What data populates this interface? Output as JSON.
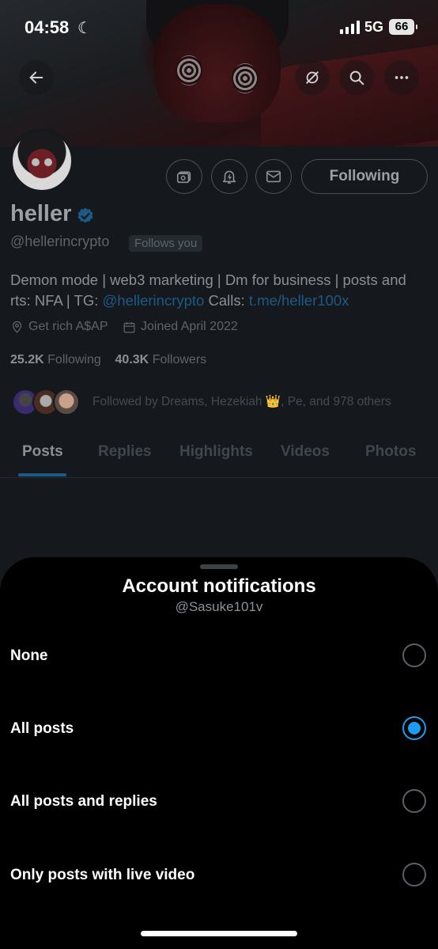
{
  "status_bar": {
    "time": "04:58",
    "network": "5G",
    "battery": "66"
  },
  "profile": {
    "name": "heller",
    "handle": "@hellerincrypto",
    "follows_you": "Follows you",
    "following_button": "Following",
    "bio_text": "Demon mode | web3 marketing | Dm for business | posts and rts: NFA | TG: ",
    "bio_link_tg": "@hellerincrypto",
    "bio_calls": " Calls: ",
    "bio_link_calls": "t.me/heller100x",
    "location": "Get rich A$AP",
    "joined": "Joined April 2022",
    "following_count": "25.2K",
    "following_label": "Following",
    "followers_count": "40.3K",
    "followers_label": "Followers",
    "followed_by": "Followed by Dreams, Hezekiah 👑, Pe, and 978 others"
  },
  "tabs": [
    "Posts",
    "Replies",
    "Highlights",
    "Videos",
    "Photos"
  ],
  "active_tab": "Posts",
  "sheet": {
    "title": "Account notifications",
    "subtitle": "@Sasuke101v",
    "options": [
      {
        "label": "None",
        "selected": false
      },
      {
        "label": "All posts",
        "selected": true
      },
      {
        "label": "All posts and replies",
        "selected": false
      },
      {
        "label": "Only posts with live video",
        "selected": false
      }
    ]
  },
  "colors": {
    "accent": "#1d9bf0",
    "sheet_bg": "#000000",
    "page_bg": "#15181c"
  },
  "icons": [
    "back-arrow-icon",
    "hide-icon",
    "search-icon",
    "more-icon",
    "subscription-icon",
    "notification-bell-icon",
    "message-icon",
    "verified-badge-icon",
    "location-icon",
    "calendar-icon"
  ]
}
